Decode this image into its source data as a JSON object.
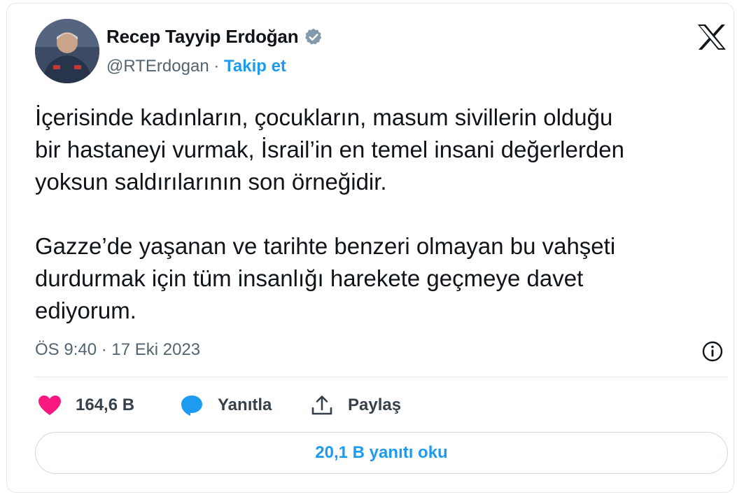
{
  "tweet": {
    "author": {
      "name": "Recep Tayyip Erdoğan",
      "handle": "@RTErdogan",
      "separator": " · ",
      "follow_label": "Takip et",
      "verified": true,
      "avatar_icon": "profile-photo"
    },
    "logo_icon": "x-logo-icon",
    "paragraphs": [
      "İçerisinde kadınların, çocukların, masum sivillerin olduğu\nbir hastaneyi vurmak, İsrail’in en temel insani değerlerden\nyoksun saldırılarının son örneğidir.",
      "Gazze’de yaşanan ve tarihte benzeri olmayan bu vahşeti\ndurdurmak için tüm insanlığı harekete geçmeye davet\nediyorum."
    ],
    "timestamp": "ÖS 9:40 · 17 Eki 2023",
    "info_icon": "info-icon",
    "actions": {
      "like_count": "164,6 B",
      "reply_label": "Yanıtla",
      "share_label": "Paylaş"
    },
    "read_replies_label": "20,1 B yanıtı oku"
  },
  "colors": {
    "accent": "#1d9bf0",
    "like": "#f91880",
    "text": "#0f1419",
    "muted": "#536471",
    "verified_badge": "#829aab"
  }
}
